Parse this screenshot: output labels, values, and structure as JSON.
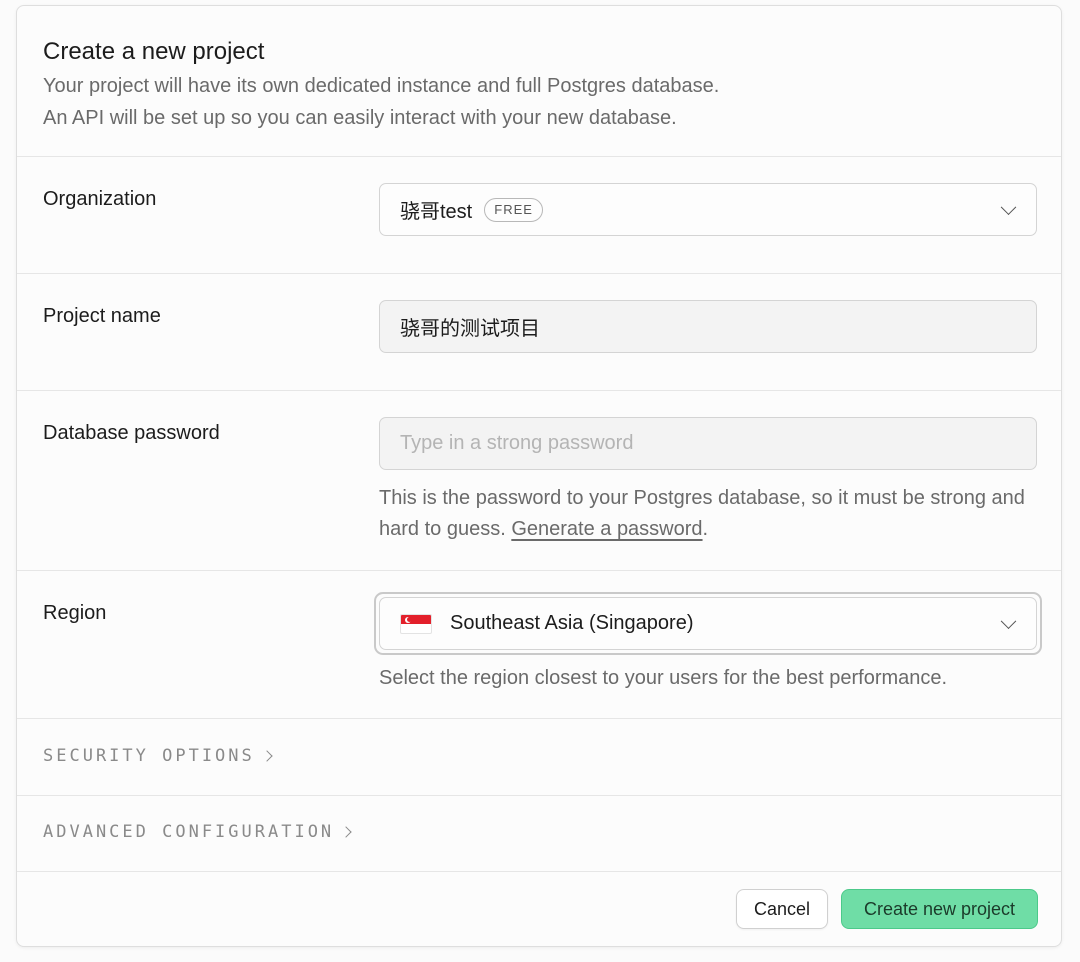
{
  "header": {
    "title": "Create a new project",
    "subtitle_line1": "Your project will have its own dedicated instance and full Postgres database.",
    "subtitle_line2": "An API will be set up so you can easily interact with your new database."
  },
  "organization": {
    "label": "Organization",
    "selected": "骁哥test",
    "badge": "FREE"
  },
  "project_name": {
    "label": "Project name",
    "value": "骁哥的测试项目"
  },
  "database_password": {
    "label": "Database password",
    "value": "",
    "placeholder": "Type in a strong password",
    "helper_text": "This is the password to your Postgres database, so it must be strong and hard to guess. ",
    "generate_link": "Generate a password",
    "helper_suffix": "."
  },
  "region": {
    "label": "Region",
    "selected": "Southeast Asia (Singapore)",
    "flag_icon": "singapore-flag-icon",
    "helper_text": "Select the region closest to your users for the best performance."
  },
  "sections": {
    "security": "SECURITY OPTIONS",
    "advanced": "ADVANCED CONFIGURATION"
  },
  "footer": {
    "cancel_label": "Cancel",
    "create_label": "Create new project",
    "accent": "#6fdda6"
  }
}
